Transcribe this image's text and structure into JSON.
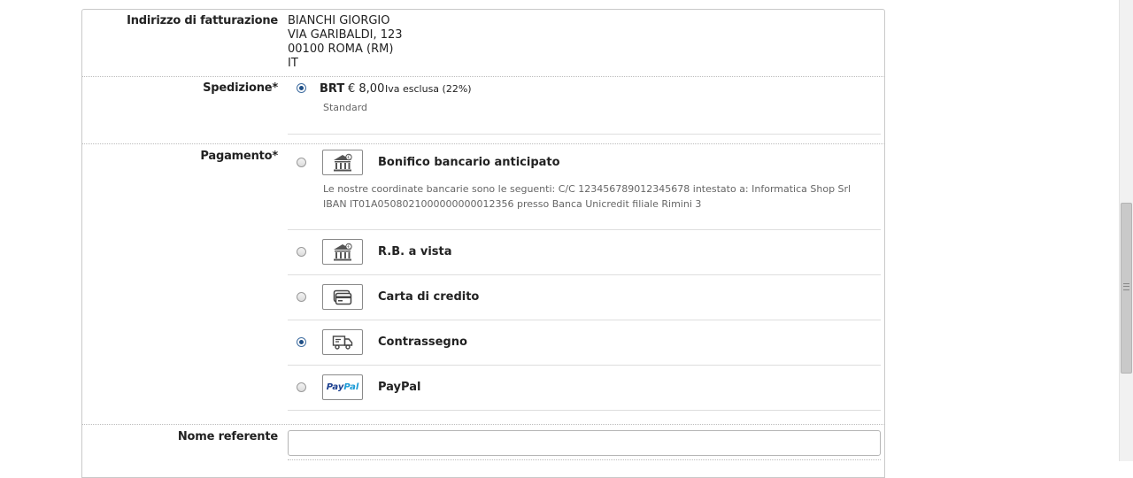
{
  "billing": {
    "label": "Indirizzo di fatturazione",
    "lines": [
      "BIANCHI GIORGIO",
      "VIA GARIBALDI, 123",
      "00100 ROMA (RM)",
      "IT"
    ]
  },
  "shipping": {
    "label": "Spedizione*",
    "options": [
      {
        "name": "BRT",
        "price": "€ 8,00",
        "vat_note": "Iva esclusa (22%)",
        "description": "Standard",
        "selected": true
      }
    ]
  },
  "payment": {
    "label": "Pagamento*",
    "options": [
      {
        "name": "Bonifico bancario anticipato",
        "icon": "bank-icon",
        "selected": false,
        "description": "Le nostre coordinate bancarie sono le seguenti: C/C 123456789012345678 intestato a: Informatica Shop Srl IBAN IT01A0508021000000000012356 presso Banca Unicredit filiale Rimini 3"
      },
      {
        "name": "R.B. a vista",
        "icon": "bank-icon",
        "selected": false
      },
      {
        "name": "Carta di credito",
        "icon": "credit-card-icon",
        "selected": false
      },
      {
        "name": "Contrassegno",
        "icon": "delivery-truck-icon",
        "selected": true
      },
      {
        "name": "PayPal",
        "icon": "paypal-logo-icon",
        "selected": false,
        "logo_text": [
          "Pay",
          "Pal"
        ]
      }
    ]
  },
  "referent": {
    "label": "Nome referente",
    "value": "",
    "placeholder": ""
  },
  "colors": {
    "radio_checked": "#1f4f86",
    "paypal_dark": "#1b3f8f",
    "paypal_light": "#1a9ad6"
  }
}
